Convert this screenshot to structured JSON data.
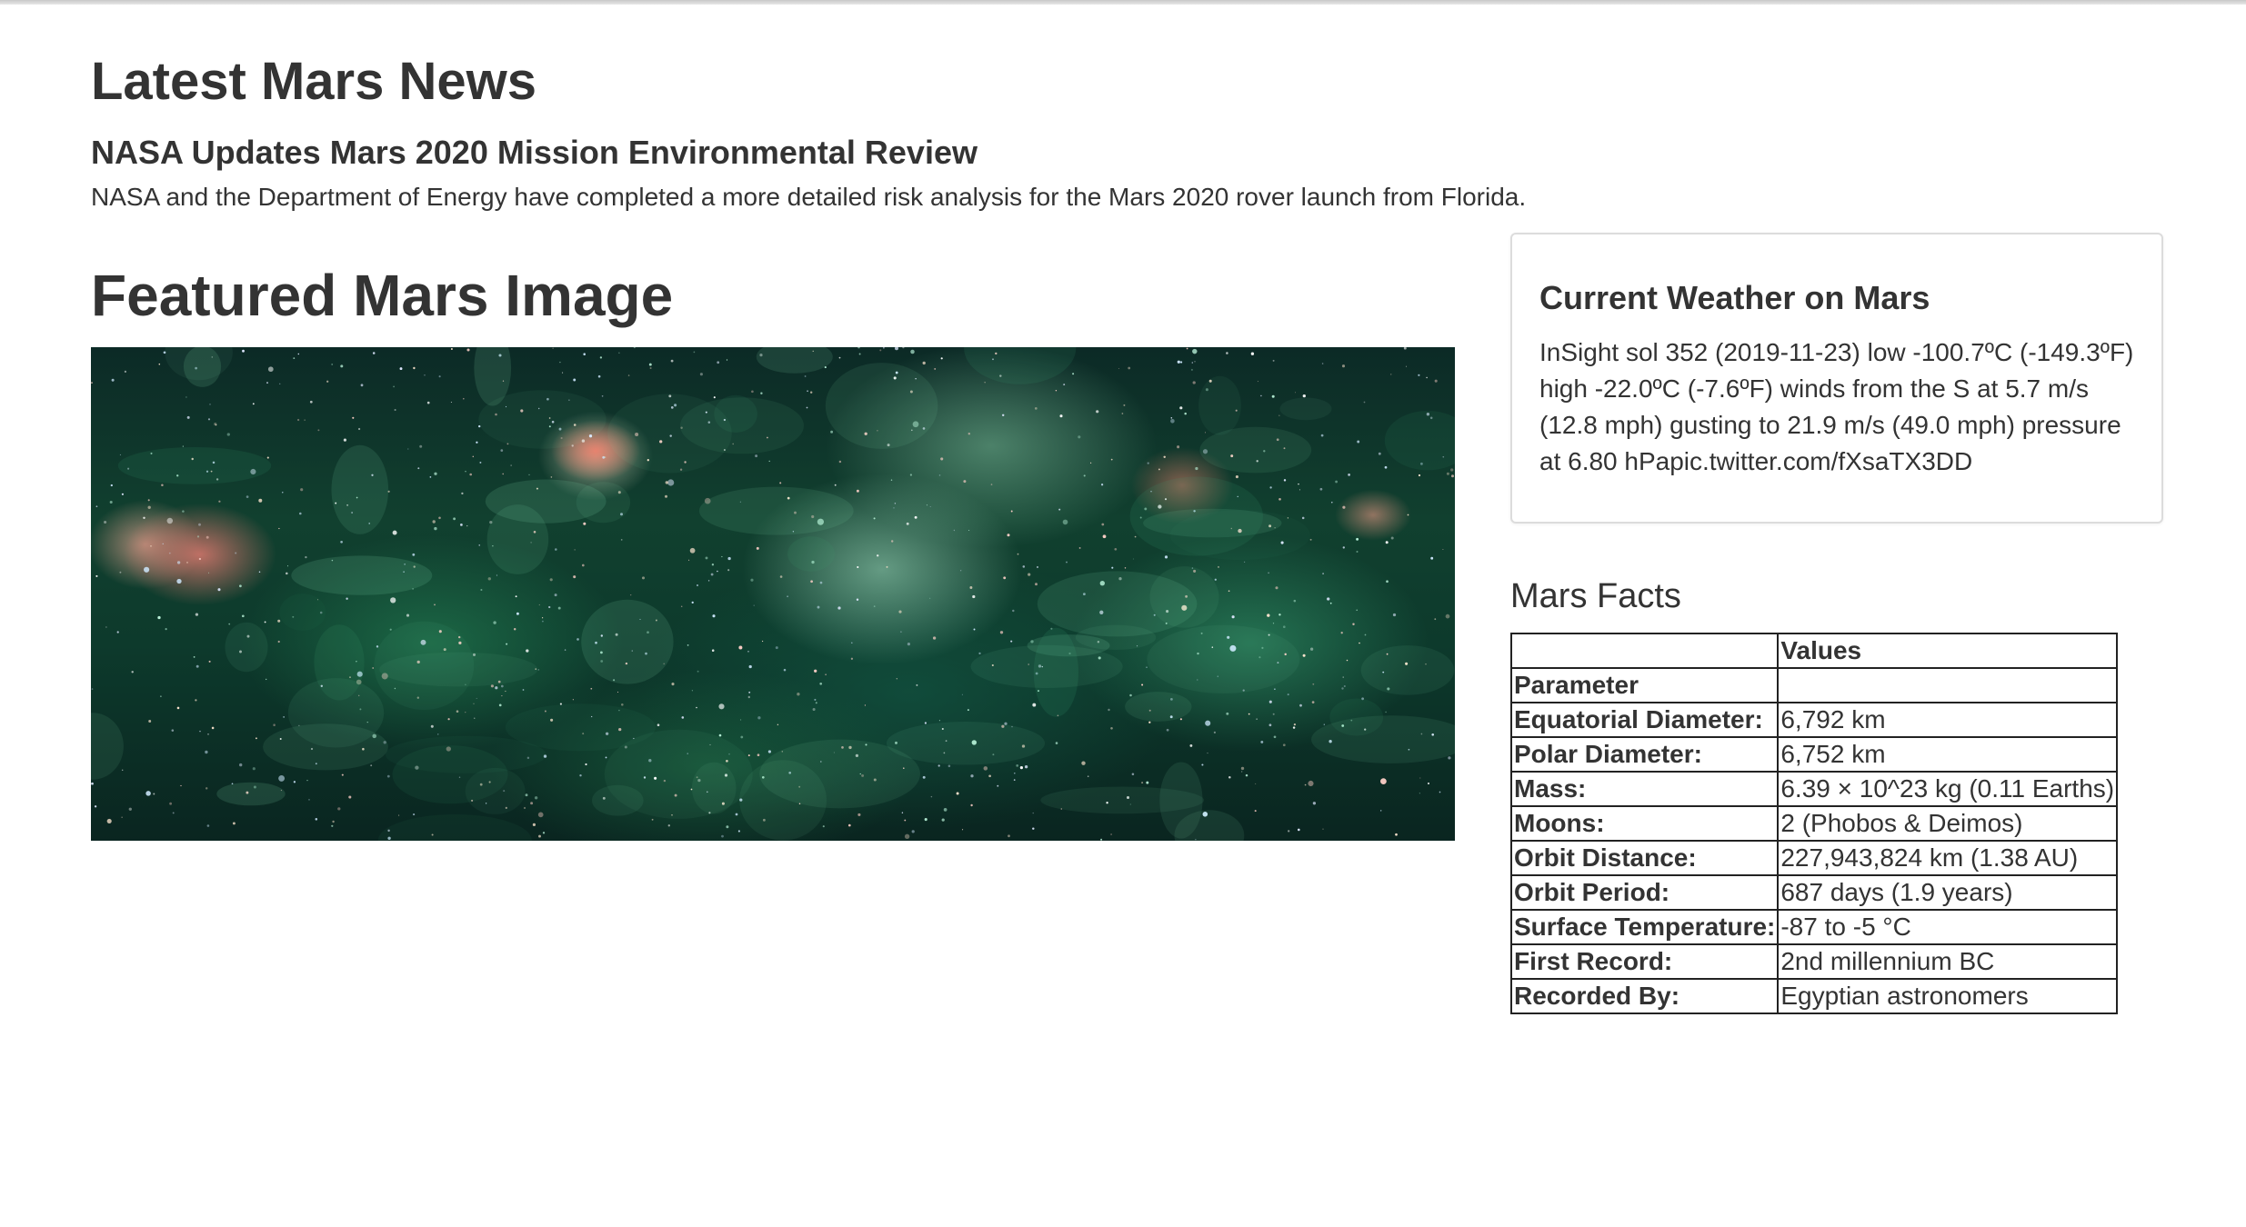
{
  "news": {
    "section_title": "Latest Mars News",
    "headline": "NASA Updates Mars 2020 Mission Environmental Review",
    "teaser": "NASA and the Department of Energy have completed a more detailed risk analysis for the Mars 2020 rover launch from Florida."
  },
  "featured": {
    "section_title": "Featured Mars Image"
  },
  "weather": {
    "title": "Current Weather on Mars",
    "text": "InSight sol 352 (2019-11-23) low -100.7ºC (-149.3ºF) high -22.0ºC (-7.6ºF) winds from the S at 5.7 m/s (12.8 mph) gusting to 21.9 m/s (49.0 mph) pressure at 6.80 hPapic.twitter.com/fXsaTX3DD"
  },
  "facts": {
    "title": "Mars Facts",
    "header_blank": "",
    "header_values": "Values",
    "index_label": "Parameter",
    "rows": [
      {
        "parameter": "Equatorial Diameter:",
        "value": "6,792 km"
      },
      {
        "parameter": "Polar Diameter:",
        "value": "6,752 km"
      },
      {
        "parameter": "Mass:",
        "value": "6.39 × 10^23 kg (0.11 Earths)"
      },
      {
        "parameter": "Moons:",
        "value": "2 (Phobos & Deimos)"
      },
      {
        "parameter": "Orbit Distance:",
        "value": "227,943,824 km (1.38 AU)"
      },
      {
        "parameter": "Orbit Period:",
        "value": "687 days (1.9 years)"
      },
      {
        "parameter": "Surface Temperature:",
        "value": "-87 to -5 °C"
      },
      {
        "parameter": "First Record:",
        "value": "2nd millennium BC"
      },
      {
        "parameter": "Recorded By:",
        "value": "Egyptian astronomers"
      }
    ]
  }
}
